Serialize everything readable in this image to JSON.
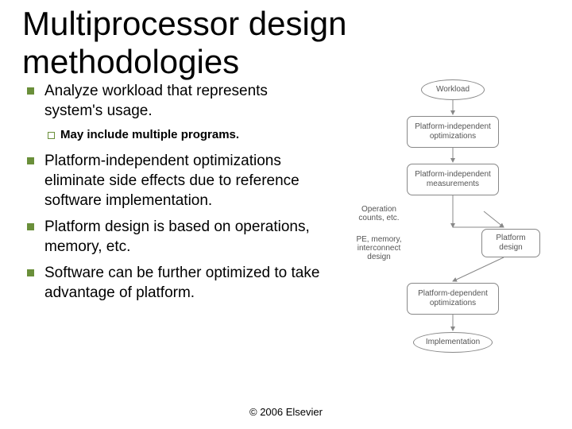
{
  "title": "Multiprocessor design methodologies",
  "bullets": {
    "b1": "Analyze workload that represents system's usage.",
    "b1a": "May include multiple programs.",
    "b2": "Platform-independent optimizations eliminate side effects due to reference software implementation.",
    "b3": "Platform design is based on operations, memory, etc.",
    "b4": "Software can be further optimized to take advantage of platform."
  },
  "diagram": {
    "n1": "Workload",
    "n2": "Platform-independent optimizations",
    "n3": "Platform-independent measurements",
    "n4": "Platform design",
    "n5": "Platform-dependent optimizations",
    "n6": "Implementation",
    "side1": "Operation counts, etc.",
    "side2": "PE, memory, interconnect design"
  },
  "footer": "© 2006 Elsevier"
}
